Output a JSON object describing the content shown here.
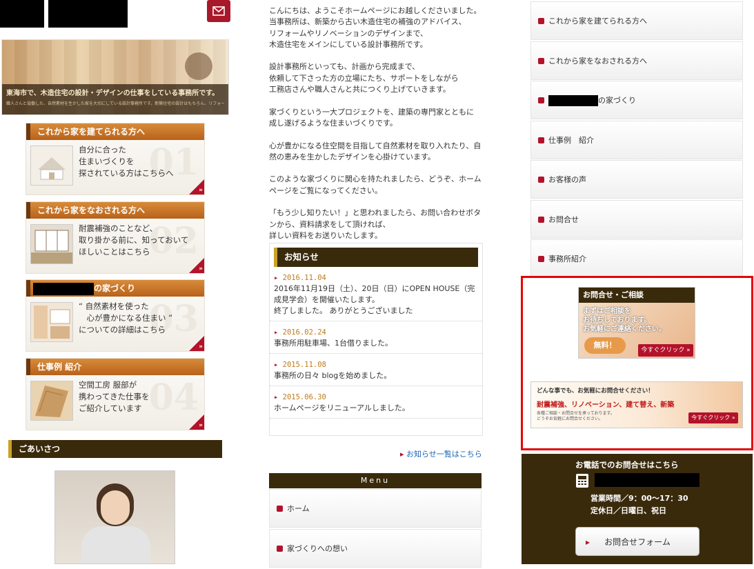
{
  "header": {
    "mail_icon": "mail-icon"
  },
  "hero": {
    "title": "東海市で、木造住宅の設計・デザインの仕事をしている事務所です。",
    "subtitle": "職人さんと協働した、自然素材を生かした家を大切にしている設計事務所です。新築住宅の設計はもちろん、リフォーム・耐震補強まで、サポートいたします。"
  },
  "cards": [
    {
      "title": "これから家を建てられる方へ",
      "lines": [
        "自分に合った",
        "住まいづくりを",
        "探されている方はこちらへ"
      ],
      "num": "01"
    },
    {
      "title": "これから家をなおされる方へ",
      "lines": [
        "耐震補強のことなど、",
        "取り掛かる前に、知っておいて",
        "ほしいことはこちら"
      ],
      "num": "02"
    },
    {
      "title": "の家づくり",
      "lines": [
        "“ 自然素材を使った",
        "　心が豊かになる住まい ”",
        "についての詳細はこちら"
      ],
      "num": "03"
    },
    {
      "title": "仕事例 紹介",
      "lines": [
        "空間工房 服部が",
        "携わってきた仕事を",
        "ご紹介しています"
      ],
      "num": "04"
    }
  ],
  "greeting": {
    "title": "ごあいさつ"
  },
  "intro": {
    "paragraphs": [
      "こんにちは、ようこそホームページにお越しくださいました。\n当事務所は、新築から古い木造住宅の補強のアドバイス、\nリフォームやリノベーションのデザインまで、\n木造住宅をメインにしている設計事務所です。",
      "設計事務所といっても、計画から完成まで、\n依頼して下さった方の立場にたち、サポートをしながら\n工務店さんや職人さんと共につくり上げていきます。",
      "家づくりという一大プロジェクトを、建築の専門家とともに\n成し遂げるような住まいづくりです。",
      "心が豊かになる住空間を目指して自然素材を取り入れたり、自\n然の恵みを生かしたデザインを心掛けています。",
      "このような家づくりに関心を持たれましたら、どうぞ、ホーム\nページをご覧になってください。",
      "「もう少し知りたい！」と思われましたら、お問い合わせボタ\nンから、資料請求をして頂ければ、\n詳しい資料をお送りいたします。"
    ]
  },
  "news": {
    "title": "お知らせ",
    "items": [
      {
        "date": "2016.11.04",
        "text": "2016年11月19日（土）、20日（日）にOPEN HOUSE（完成見学会）を開催いたします。\n終了しました。 ありがとうございました"
      },
      {
        "date": "2016.02.24",
        "text": "事務所用駐車場、1台借りました。"
      },
      {
        "date": "2015.11.08",
        "text": "事務所の日々 blogを始めました。"
      },
      {
        "date": "2015.06.30",
        "text": "ホームページをリニューアルしました。"
      }
    ],
    "more": "お知らせ一覧はこちら"
  },
  "menu": {
    "title": "Menu",
    "items": [
      "ホーム",
      "家づくりへの想い"
    ]
  },
  "nav": {
    "items": [
      "これから家を建てられる方へ",
      "これから家をなおされる方へ",
      "の家づくり",
      "仕事例　紹介",
      "お客様の声",
      "お問合せ",
      "事務所紹介"
    ]
  },
  "ad1": {
    "title": "お問合せ・ご相談",
    "text": "まずはご相談を\nお待ちしております。\nお気軽にご連絡ください。",
    "free": "無料！",
    "click": "今すぐクリック »"
  },
  "ad2": {
    "line1": "どんな事でも、お気軽にお問合せください！",
    "line2": "耐震補強、リノベーション、建て替え、新築",
    "line3": "各種ご相談・お問合せを承っております。\nどうぞお気軽にお問合せください。",
    "click": "今すぐクリック »"
  },
  "contact": {
    "title": "お電話でのお問合せはこちら",
    "hours": "営業時間／9：00～17：30\n定休日／日曜日、祝日",
    "button": "お問合せフォーム"
  },
  "colors": {
    "brand_dark": "#3a2a0c",
    "accent": "#b3122a",
    "orange": "#c8732a",
    "highlight": "#e60000"
  }
}
